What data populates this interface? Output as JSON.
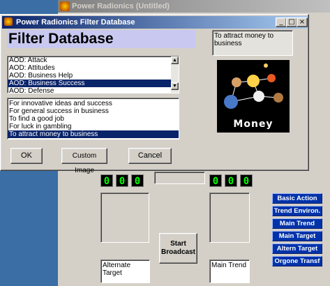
{
  "main_window": {
    "title": "Power Radionics (Untitled)",
    "menu_hint": "Filter Database",
    "start_label": "Start\nBroadcast",
    "alternate_target_label": "Alternate Target",
    "main_trend_label": "Main Trend",
    "counter_left": [
      "0",
      "0",
      "0"
    ],
    "counter_right": [
      "0",
      "0",
      "0"
    ],
    "side_buttons": [
      "Basic Action",
      "Trend Environ.",
      "Main Trend",
      "Main Target",
      "Altern Target",
      "Orgone Transf"
    ]
  },
  "dialog": {
    "title": "Power Radionics Filter Database",
    "heading": "Filter Database",
    "description": "To attract money to business",
    "image_caption": "Money",
    "categories": [
      "AOD: Attack",
      "AOD: Attitudes",
      "AOD: Business Help",
      "AOD: Business Success",
      "AOD: Defense"
    ],
    "categories_selected_index": 3,
    "filters": [
      "For innovative ideas and success",
      "For general success in business",
      "To find a good job",
      "For luck in gambling",
      "To attract money to business"
    ],
    "filters_selected_index": 4,
    "buttons": {
      "ok": "OK",
      "custom": "Custom Image",
      "cancel": "Cancel"
    },
    "caption_buttons": {
      "minimize": "_",
      "maximize": "□",
      "close": "×"
    }
  },
  "colors": {
    "desktop": "#3a6ea5",
    "title_active": "#0a246a",
    "lcd": "#00ff00",
    "side_button": "#0033aa"
  }
}
